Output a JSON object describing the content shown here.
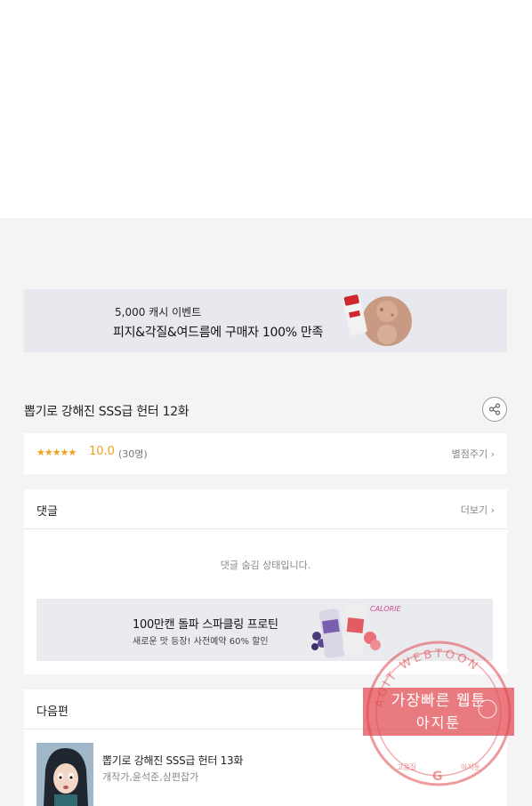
{
  "ad_banner": {
    "subtitle": "5,000 캐시 이벤트",
    "headline": "피지&각질&여드름에 구매자 100% 만족"
  },
  "episode": {
    "title": "뽑기로 강해진 SSS급 헌터 12화",
    "share_icon": "share-icon"
  },
  "rating": {
    "stars": "★★★★★",
    "stars_filled": 5,
    "value": "10.0",
    "count": "(30명)",
    "rate_link": "별점주기"
  },
  "comments": {
    "label": "댓글",
    "more": "더보기",
    "hidden_message": "댓글 숨김 상태입니다."
  },
  "ad_drink": {
    "headline": "100만캔 돌파 스파클링 프로틴",
    "subtitle": "새로운 맛 등장! 사전예약 60% 할인",
    "can_text": "CALORIE"
  },
  "next_episode": {
    "label": "다음편",
    "title": "뽑기로 강해진 SSS급 헌터 13화",
    "authors": "개작가,윤석준,삼편잡가"
  },
  "watermark": {
    "ring_text": "AGIT WEBTOON",
    "line1": "가장빠른 웹툰",
    "line2": "아지툰",
    "bottom_left": "고품질",
    "bottom_right": "아지툰"
  },
  "colors": {
    "accent_star": "#f0a21b",
    "watermark": "#e0484f"
  }
}
